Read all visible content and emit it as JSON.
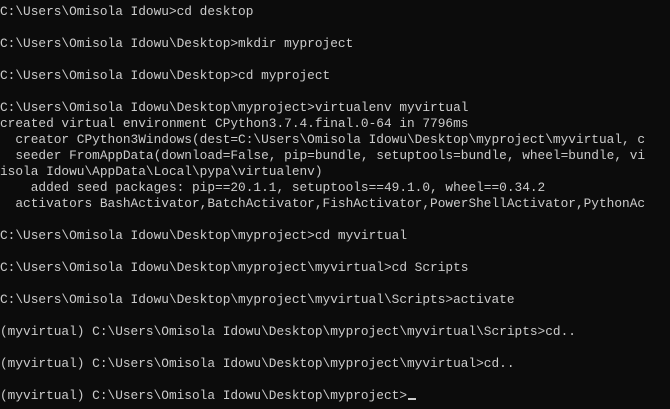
{
  "terminal": {
    "lines": [
      "C:\\Users\\Omisola Idowu>cd desktop",
      "",
      "C:\\Users\\Omisola Idowu\\Desktop>mkdir myproject",
      "",
      "C:\\Users\\Omisola Idowu\\Desktop>cd myproject",
      "",
      "C:\\Users\\Omisola Idowu\\Desktop\\myproject>virtualenv myvirtual",
      "created virtual environment CPython3.7.4.final.0-64 in 7796ms",
      "  creator CPython3Windows(dest=C:\\Users\\Omisola Idowu\\Desktop\\myproject\\myvirtual, c",
      "  seeder FromAppData(download=False, pip=bundle, setuptools=bundle, wheel=bundle, vi",
      "isola Idowu\\AppData\\Local\\pypa\\virtualenv)",
      "    added seed packages: pip==20.1.1, setuptools==49.1.0, wheel==0.34.2",
      "  activators BashActivator,BatchActivator,FishActivator,PowerShellActivator,PythonAc",
      "",
      "C:\\Users\\Omisola Idowu\\Desktop\\myproject>cd myvirtual",
      "",
      "C:\\Users\\Omisola Idowu\\Desktop\\myproject\\myvirtual>cd Scripts",
      "",
      "C:\\Users\\Omisola Idowu\\Desktop\\myproject\\myvirtual\\Scripts>activate",
      "",
      "(myvirtual) C:\\Users\\Omisola Idowu\\Desktop\\myproject\\myvirtual\\Scripts>cd..",
      "",
      "(myvirtual) C:\\Users\\Omisola Idowu\\Desktop\\myproject\\myvirtual>cd..",
      "",
      "(myvirtual) C:\\Users\\Omisola Idowu\\Desktop\\myproject>"
    ],
    "colors": {
      "background": "#0c0c0c",
      "text": "#cccccc"
    }
  }
}
